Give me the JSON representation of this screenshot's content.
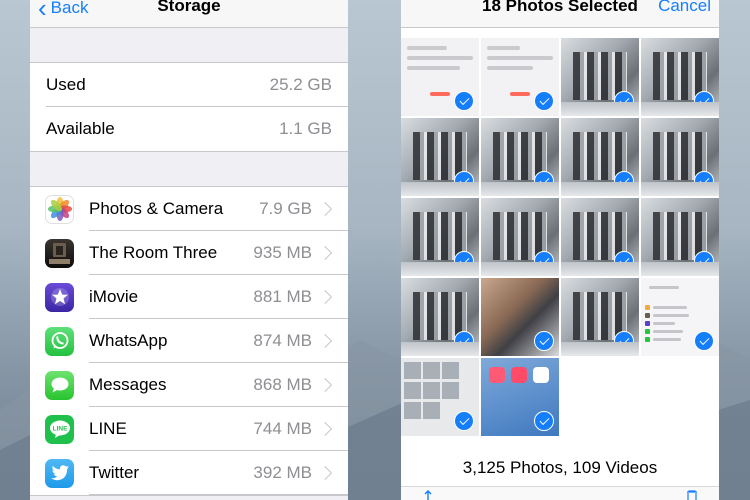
{
  "storage": {
    "back_label": "Back",
    "title": "Storage",
    "summary": [
      {
        "label": "Used",
        "value": "25.2 GB"
      },
      {
        "label": "Available",
        "value": "1.1 GB"
      }
    ],
    "apps": [
      {
        "name": "Photos & Camera",
        "size": "7.9 GB",
        "icon": "photos-icon"
      },
      {
        "name": "The Room Three",
        "size": "935 MB",
        "icon": "the-room-three-icon"
      },
      {
        "name": "iMovie",
        "size": "881 MB",
        "icon": "imovie-icon"
      },
      {
        "name": "WhatsApp",
        "size": "874 MB",
        "icon": "whatsapp-icon"
      },
      {
        "name": "Messages",
        "size": "868 MB",
        "icon": "messages-icon"
      },
      {
        "name": "LINE",
        "size": "744 MB",
        "icon": "line-icon"
      },
      {
        "name": "Twitter",
        "size": "392 MB",
        "icon": "twitter-icon"
      }
    ]
  },
  "photos": {
    "title": "18 Photos Selected",
    "cancel_label": "Cancel",
    "count_summary": "3,125 Photos, 109 Videos"
  },
  "colors": {
    "ios_blue": "#157efb",
    "background_gray": "#efeff4",
    "secondary_text": "#8e8e93"
  }
}
